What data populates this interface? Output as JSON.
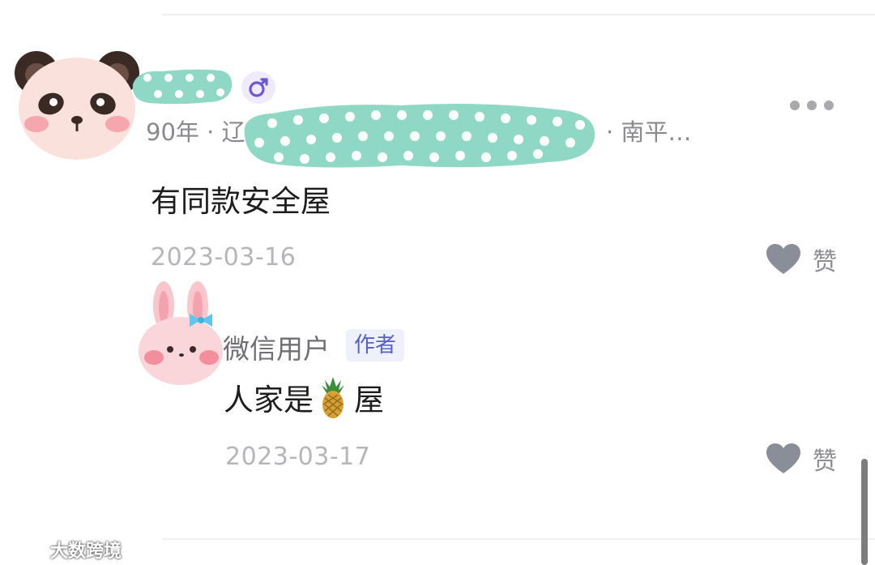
{
  "comment": {
    "meta_left": "90年 · 辽",
    "meta_right": "· 南平…",
    "text": "有同款安全屋",
    "date": "2023-03-16",
    "like_label": "赞"
  },
  "reply": {
    "username": "微信用户",
    "author_badge": "作者",
    "text_before": "人家是",
    "text_after": "屋",
    "date": "2023-03-17",
    "like_label": "赞"
  },
  "watermark": {
    "text": "大数跨境"
  },
  "colors": {
    "blob_teal": "#8fd8c5",
    "gender_purple": "#6b58d6",
    "badge_text": "#5661c8",
    "heart_gray": "#8a8e99"
  },
  "icons": {
    "gender": "male-icon",
    "more": "more-icon",
    "like": "heart-icon",
    "emoji": "pineapple-emoji"
  }
}
